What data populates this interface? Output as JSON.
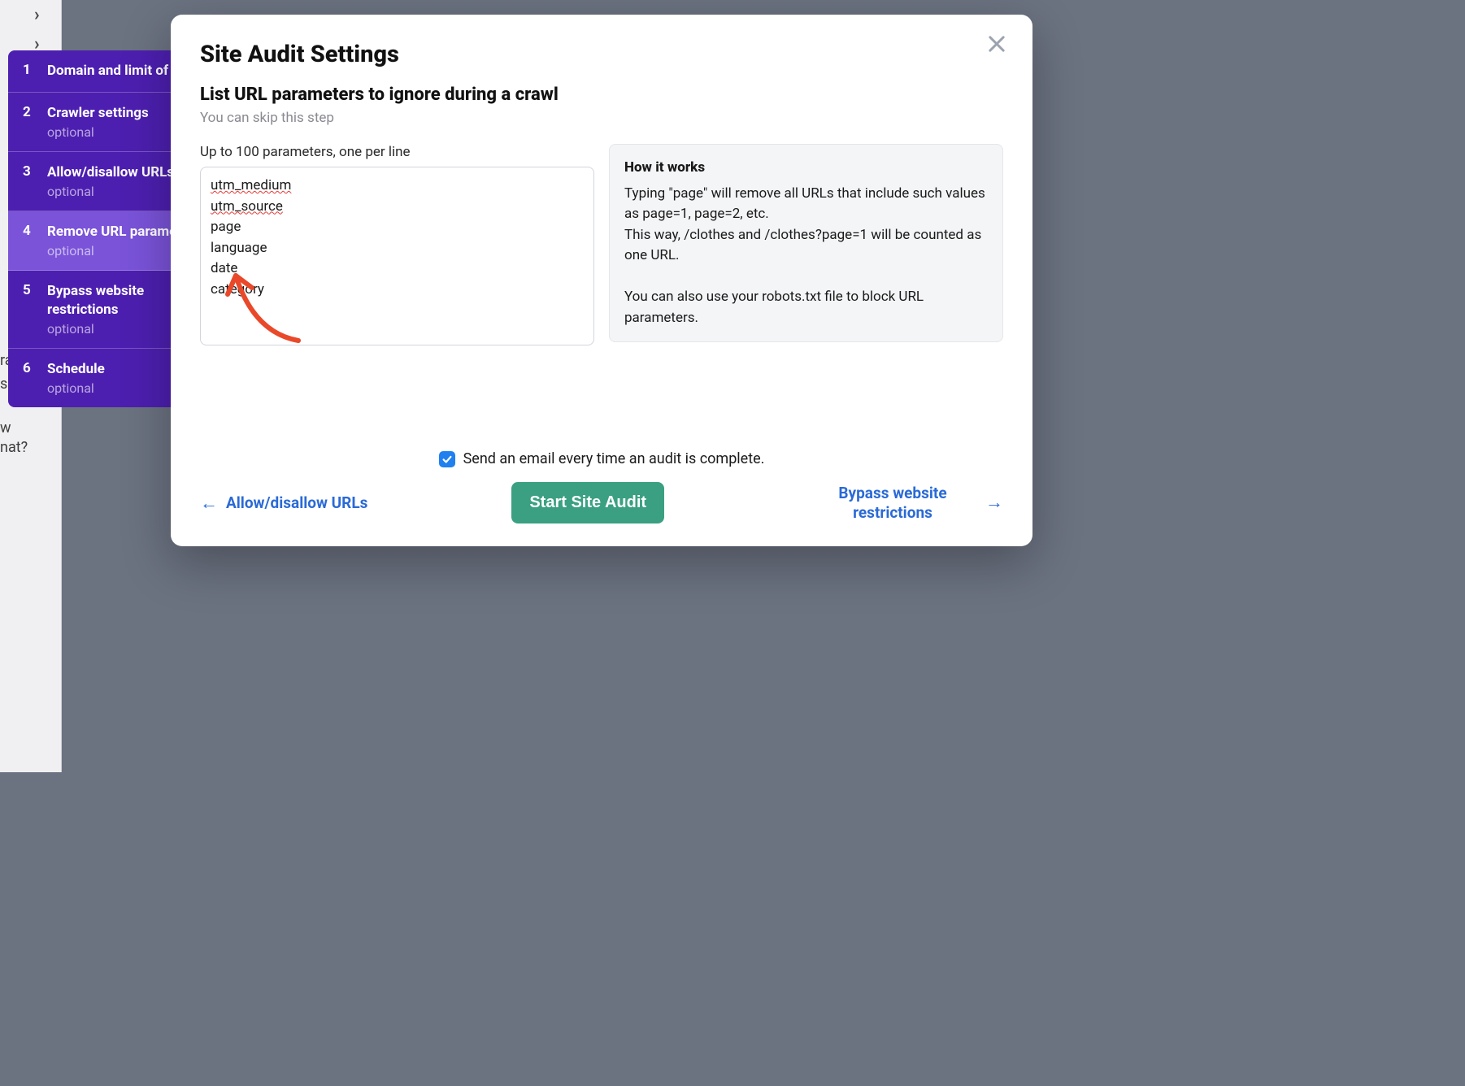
{
  "background": {
    "text_fragments": [
      "ram",
      "se or",
      "w",
      "nat?"
    ]
  },
  "sidebar": {
    "steps": [
      {
        "num": "1",
        "title": "Domain and limit of pages",
        "sub": ""
      },
      {
        "num": "2",
        "title": "Crawler settings",
        "sub": "optional"
      },
      {
        "num": "3",
        "title": "Allow/disallow URLs",
        "sub": "optional"
      },
      {
        "num": "4",
        "title": "Remove URL parameters",
        "sub": "optional"
      },
      {
        "num": "5",
        "title": "Bypass website restrictions",
        "sub": "optional"
      },
      {
        "num": "6",
        "title": "Schedule",
        "sub": "optional"
      }
    ],
    "active_index": 3
  },
  "modal": {
    "title": "Site Audit Settings",
    "subtitle": "List URL parameters to ignore during a crawl",
    "skip_text": "You can skip this step",
    "field_label": "Up to 100 parameters, one per line",
    "textarea_value": "utm_medium\nutm_source\npage\nlanguage\ndate\ncategory",
    "info": {
      "title": "How it works",
      "body1": "Typing \"page\" will remove all URLs that include such values as page=1, page=2, etc.",
      "body2": "This way, /clothes and /clothes?page=1 will be counted as one URL.",
      "body3": "You can also use your robots.txt file to block URL parameters."
    },
    "email_label": "Send an email every time an audit is complete.",
    "email_checked": true,
    "prev_label": "Allow/disallow URLs",
    "next_label": "Bypass website restrictions",
    "primary_label": "Start Site Audit"
  }
}
